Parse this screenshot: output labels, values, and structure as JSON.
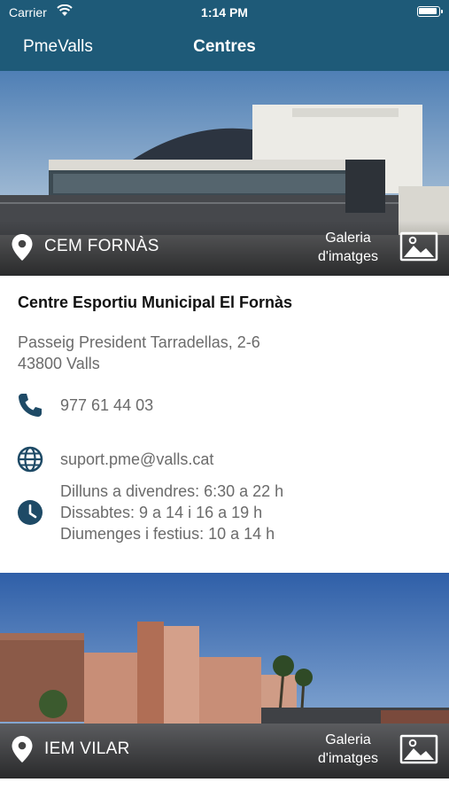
{
  "status": {
    "carrier": "Carrier",
    "time": "1:14 PM"
  },
  "nav": {
    "back_label": "PmeValls",
    "title": "Centres"
  },
  "centres": [
    {
      "short_name": "CEM FORNÀS",
      "gallery_line1": "Galeria",
      "gallery_line2": "d'imatges",
      "full_name": "Centre Esportiu Municipal El Fornàs",
      "address_line1": "Passeig President Tarradellas, 2-6",
      "address_line2": "43800 Valls",
      "phone": "977 61 44 03",
      "email": "suport.pme@valls.cat",
      "hours": [
        "Dilluns a divendres: 6:30 a 22 h",
        "Dissabtes: 9 a 14 i 16 a 19 h",
        "Diumenges i festius: 10 a 14 h"
      ],
      "building_sign": "Centre Esportiu Municipal El Fornàs"
    },
    {
      "short_name": "IEM VILAR",
      "gallery_line1": "Galeria",
      "gallery_line2": "d'imatges"
    }
  ],
  "colors": {
    "nav_bar": "#1e5a78",
    "icon_accent": "#1e4a66",
    "secondary_text": "#6b6b6b"
  },
  "icons": {
    "location": "location-pin-icon",
    "gallery": "image-gallery-icon",
    "phone": "phone-icon",
    "web": "globe-icon",
    "hours": "clock-icon"
  }
}
